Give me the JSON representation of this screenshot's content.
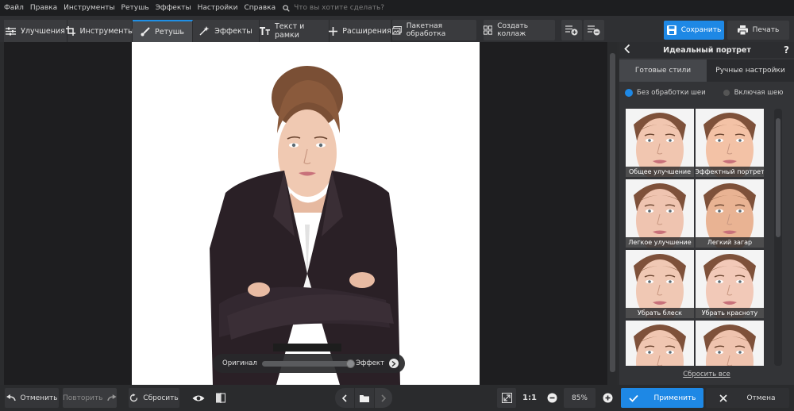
{
  "menu": {
    "items": [
      "Файл",
      "Правка",
      "Инструменты",
      "Ретушь",
      "Эффекты",
      "Настройки",
      "Справка"
    ],
    "search_placeholder": "Что вы хотите сделать?"
  },
  "toolbar": {
    "tabs": [
      {
        "label": "Улучшения",
        "icon": "sliders-icon"
      },
      {
        "label": "Инструменты",
        "icon": "crop-icon"
      },
      {
        "label": "Ретушь",
        "icon": "brush-icon",
        "active": true
      },
      {
        "label": "Эффекты",
        "icon": "magic-wand-icon"
      },
      {
        "label": "Текст и рамки",
        "icon": "text-icon"
      },
      {
        "label": "Расширения",
        "icon": "plus-icon"
      }
    ],
    "batch_label": "Пакетная обработка",
    "collage_label": "Создать коллаж",
    "save_label": "Сохранить",
    "print_label": "Печать"
  },
  "compare": {
    "original_label": "Оригинал",
    "effect_label": "Эффект",
    "position": 1.0
  },
  "panel": {
    "title": "Идеальный портрет",
    "help": "?",
    "tabs": [
      "Готовые стили",
      "Ручные настройки"
    ],
    "active_tab": 0,
    "radio": [
      {
        "label": "Без обработки шеи",
        "checked": true
      },
      {
        "label": "Включая шею",
        "checked": false
      }
    ],
    "presets": [
      "Общее улучшение",
      "Эффектный портрет",
      "Легкое улучшение",
      "Легкий загар",
      "Убрать блеск",
      "Убрать красноту",
      "",
      ""
    ],
    "reset_all": "Сбросить все"
  },
  "bottom": {
    "undo_label": "Отменить",
    "redo_label": "Повторить",
    "reset_label": "Сбросить",
    "ratio_label": "1:1",
    "zoom": "85%",
    "apply_label": "Применить",
    "cancel_label": "Отмена"
  },
  "colors": {
    "accent": "#1e88e5",
    "background": "#2b2c2e",
    "panel": "#333437"
  }
}
